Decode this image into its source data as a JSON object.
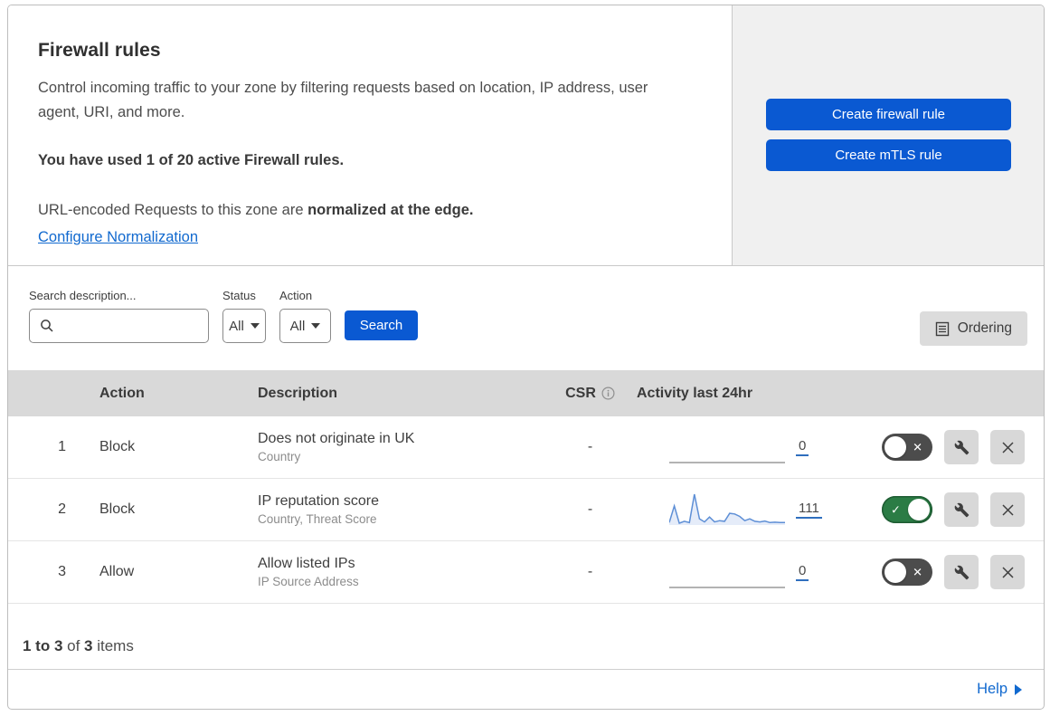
{
  "header": {
    "title": "Firewall rules",
    "description": "Control incoming traffic to your zone by filtering requests based on location, IP address, user agent, URI, and more.",
    "usage": "You have used 1 of 20 active Firewall rules.",
    "norm_prefix": "URL-encoded Requests to this zone are ",
    "norm_bold": "normalized at the edge.",
    "norm_link": "Configure Normalization",
    "create_firewall_button": "Create firewall rule",
    "create_mtls_button": "Create mTLS rule"
  },
  "filters": {
    "search_label": "Search description...",
    "status_label": "Status",
    "status_value": "All",
    "action_label": "Action",
    "action_value": "All",
    "search_button": "Search",
    "ordering_button": "Ordering"
  },
  "table": {
    "columns": {
      "action": "Action",
      "description": "Description",
      "csr": "CSR",
      "activity": "Activity last 24hr"
    },
    "rows": [
      {
        "priority": "1",
        "action": "Block",
        "description": "Does not originate in UK",
        "fields": "Country",
        "csr": "-",
        "activity_count": "0",
        "enabled": false,
        "sparkline": []
      },
      {
        "priority": "2",
        "action": "Block",
        "description": "IP reputation score",
        "fields": "Country, Threat Score",
        "csr": "-",
        "activity_count": "111",
        "enabled": true,
        "sparkline": [
          8,
          62,
          6,
          12,
          8,
          100,
          20,
          10,
          26,
          10,
          14,
          12,
          38,
          36,
          28,
          14,
          20,
          12,
          10,
          13,
          8,
          9,
          8,
          8
        ]
      },
      {
        "priority": "3",
        "action": "Allow",
        "description": "Allow listed IPs",
        "fields": "IP Source Address",
        "csr": "-",
        "activity_count": "0",
        "enabled": false,
        "sparkline": []
      }
    ]
  },
  "footer": {
    "range": "1 to 3",
    "of": " of ",
    "total": "3",
    "items": " items",
    "help": "Help"
  },
  "colors": {
    "primary_blue": "#0a59d2",
    "link_blue": "#1169cf",
    "toggle_on_green": "#2b7c45",
    "toggle_off_gray": "#4c4c4c",
    "table_header_bg": "#d9d9d9",
    "side_panel_bg": "#f0f0f0",
    "sparkline_blue": "#5e8fd6"
  }
}
